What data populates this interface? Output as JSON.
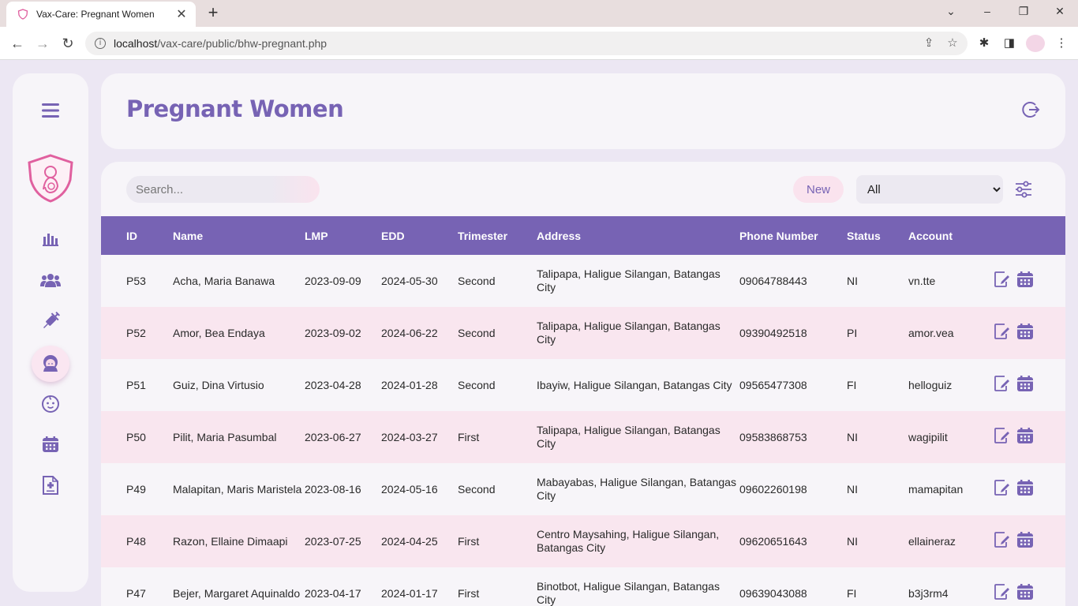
{
  "browser": {
    "tab_title": "Vax-Care: Pregnant Women",
    "url_host": "localhost",
    "url_path": "/vax-care/public/bhw-pregnant.php"
  },
  "sidebar": {
    "items": [
      {
        "name": "menu"
      },
      {
        "name": "dashboard"
      },
      {
        "name": "users"
      },
      {
        "name": "vaccines"
      },
      {
        "name": "pregnant-women",
        "active": true
      },
      {
        "name": "babies"
      },
      {
        "name": "calendar"
      },
      {
        "name": "reports"
      }
    ]
  },
  "header": {
    "title": "Pregnant Women"
  },
  "toolbar": {
    "search_placeholder": "Search...",
    "new_label": "New",
    "filter_selected": "All"
  },
  "table": {
    "columns": [
      "ID",
      "Name",
      "LMP",
      "EDD",
      "Trimester",
      "Address",
      "Phone Number",
      "Status",
      "Account"
    ],
    "rows": [
      {
        "id": "P53",
        "name": "Acha, Maria Banawa",
        "lmp": "2023-09-09",
        "edd": "2024-05-30",
        "trimester": "Second",
        "address": "Talipapa, Haligue Silangan, Batangas City",
        "phone": "09064788443",
        "status": "NI",
        "account": "vn.tte"
      },
      {
        "id": "P52",
        "name": "Amor, Bea Endaya",
        "lmp": "2023-09-02",
        "edd": "2024-06-22",
        "trimester": "Second",
        "address": "Talipapa, Haligue Silangan, Batangas City",
        "phone": "09390492518",
        "status": "PI",
        "account": "amor.vea"
      },
      {
        "id": "P51",
        "name": "Guiz, Dina Virtusio",
        "lmp": "2023-04-28",
        "edd": "2024-01-28",
        "trimester": "Second",
        "address": "Ibayiw, Haligue Silangan, Batangas City",
        "phone": "09565477308",
        "status": "FI",
        "account": "helloguiz"
      },
      {
        "id": "P50",
        "name": "Pilit, Maria Pasumbal",
        "lmp": "2023-06-27",
        "edd": "2024-03-27",
        "trimester": "First",
        "address": "Talipapa, Haligue Silangan, Batangas City",
        "phone": "09583868753",
        "status": "NI",
        "account": "wagipilit"
      },
      {
        "id": "P49",
        "name": "Malapitan, Maris Maristela",
        "lmp": "2023-08-16",
        "edd": "2024-05-16",
        "trimester": "Second",
        "address": "Mabayabas, Haligue Silangan, Batangas City",
        "phone": "09602260198",
        "status": "NI",
        "account": "mamapitan"
      },
      {
        "id": "P48",
        "name": "Razon, Ellaine Dimaapi",
        "lmp": "2023-07-25",
        "edd": "2024-04-25",
        "trimester": "First",
        "address": "Centro Maysahing, Haligue Silangan, Batangas City",
        "phone": "09620651643",
        "status": "NI",
        "account": "ellaineraz"
      },
      {
        "id": "P47",
        "name": "Bejer, Margaret Aquinaldo",
        "lmp": "2023-04-17",
        "edd": "2024-01-17",
        "trimester": "First",
        "address": "Binotbot, Haligue Silangan, Batangas City",
        "phone": "09639043088",
        "status": "FI",
        "account": "b3j3rm4"
      }
    ]
  },
  "colors": {
    "primary": "#7763b4",
    "pink": "#e6589f",
    "row_alt": "#f9e6ef"
  }
}
